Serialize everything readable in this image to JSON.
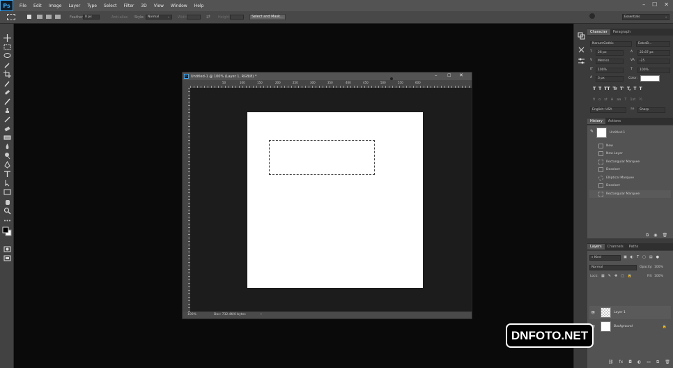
{
  "app": {
    "logo": "Ps"
  },
  "menu": [
    "File",
    "Edit",
    "Image",
    "Layer",
    "Type",
    "Select",
    "Filter",
    "3D",
    "View",
    "Window",
    "Help"
  ],
  "options": {
    "feather_label": "Feather:",
    "feather_value": "0 px",
    "antialias_label": "Anti-alias",
    "style_label": "Style:",
    "style_value": "Normal",
    "width_label": "Width:",
    "height_label": "Height:",
    "select_mask": "Select and Mask...",
    "workspace": "Essentials"
  },
  "document": {
    "title": "Untitled-1 @ 100% (Layer 1, RGB/8) *",
    "zoom": "100%",
    "doc_size": "Doc: 732.4K/0 bytes",
    "ruler_labels": [
      "50",
      "100",
      "150",
      "200",
      "250",
      "300",
      "350",
      "400",
      "450",
      "500",
      "550",
      "600"
    ]
  },
  "character": {
    "tab_character": "Character",
    "tab_paragraph": "Paragraph",
    "font_family": "NanumGothic",
    "font_style": "ExtraB...",
    "size": "26 px",
    "leading": "22.87 px",
    "kerning": "Metrics",
    "tracking": "-25",
    "vscale": "100%",
    "hscale": "100%",
    "baseline": "3 px",
    "color_label": "Color:",
    "styles": [
      "T",
      "T",
      "TT",
      "Tr",
      "T'",
      "T,",
      "T",
      "T"
    ],
    "language": "English: USA",
    "antialias": "Sharp"
  },
  "history": {
    "tab_history": "History",
    "tab_actions": "Actions",
    "snapshot": "Untitled-1",
    "items": [
      "New",
      "New Layer",
      "Rectangular Marquee",
      "Deselect",
      "Elliptical Marquee",
      "Deselect",
      "Rectangular Marquee"
    ]
  },
  "layers": {
    "tab_layers": "Layers",
    "tab_channels": "Channels",
    "tab_paths": "Paths",
    "kind": "Kind",
    "blend": "Normal",
    "opacity_label": "Opacity:",
    "opacity": "100%",
    "lock_label": "Lock:",
    "fill_label": "Fill:",
    "fill": "100%",
    "items": [
      {
        "name": "Layer 1"
      },
      {
        "name": "Background"
      }
    ]
  },
  "watermark": "DNFOTO.NET"
}
